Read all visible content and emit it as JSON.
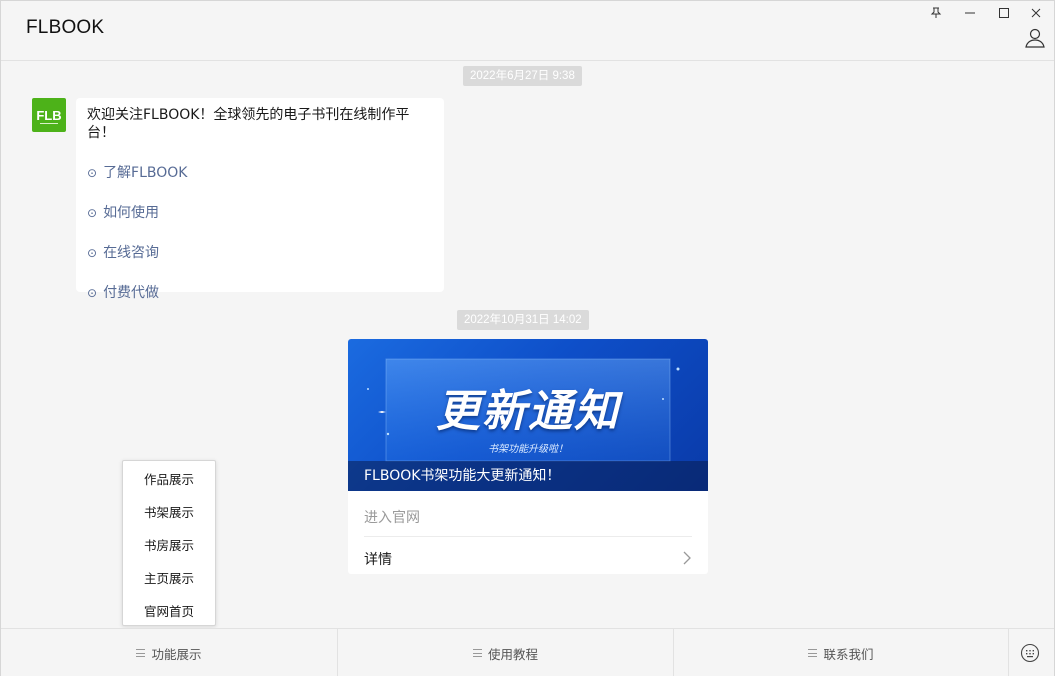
{
  "window": {
    "app_title": "FLBOOK",
    "controls": [
      "pin-icon",
      "minimize-icon",
      "maximize-icon",
      "close-icon"
    ]
  },
  "chat": {
    "timestamps": [
      "2022年6月27日  9:38",
      "2022年10月31日  14:02"
    ],
    "welcome": {
      "avatar_text": "FLB",
      "text": "欢迎关注FLBOOK！全球领先的电子书刊在线制作平台！",
      "links": [
        {
          "bullet": "⊙",
          "label": "了解FLBOOK"
        },
        {
          "bullet": "⊙",
          "label": "如何使用"
        },
        {
          "bullet": "⊙",
          "label": "在线咨询"
        },
        {
          "bullet": "⊙",
          "label": "付费代做"
        }
      ]
    },
    "article": {
      "banner_title": "更新通知",
      "banner_subtitle": "书架功能升级啦！",
      "caption": "FLBOOK书架功能大更新通知！",
      "sub_action": "进入官网",
      "detail_label": "详情"
    }
  },
  "popup_menu": {
    "items": [
      "作品展示",
      "书架展示",
      "书房展示",
      "主页展示",
      "官网首页"
    ]
  },
  "bottom_menu": {
    "tabs": [
      "功能展示",
      "使用教程",
      "联系我们"
    ]
  },
  "colors": {
    "link": "#576b95",
    "avatar": "#4db219",
    "banner": "#1b6be0"
  }
}
